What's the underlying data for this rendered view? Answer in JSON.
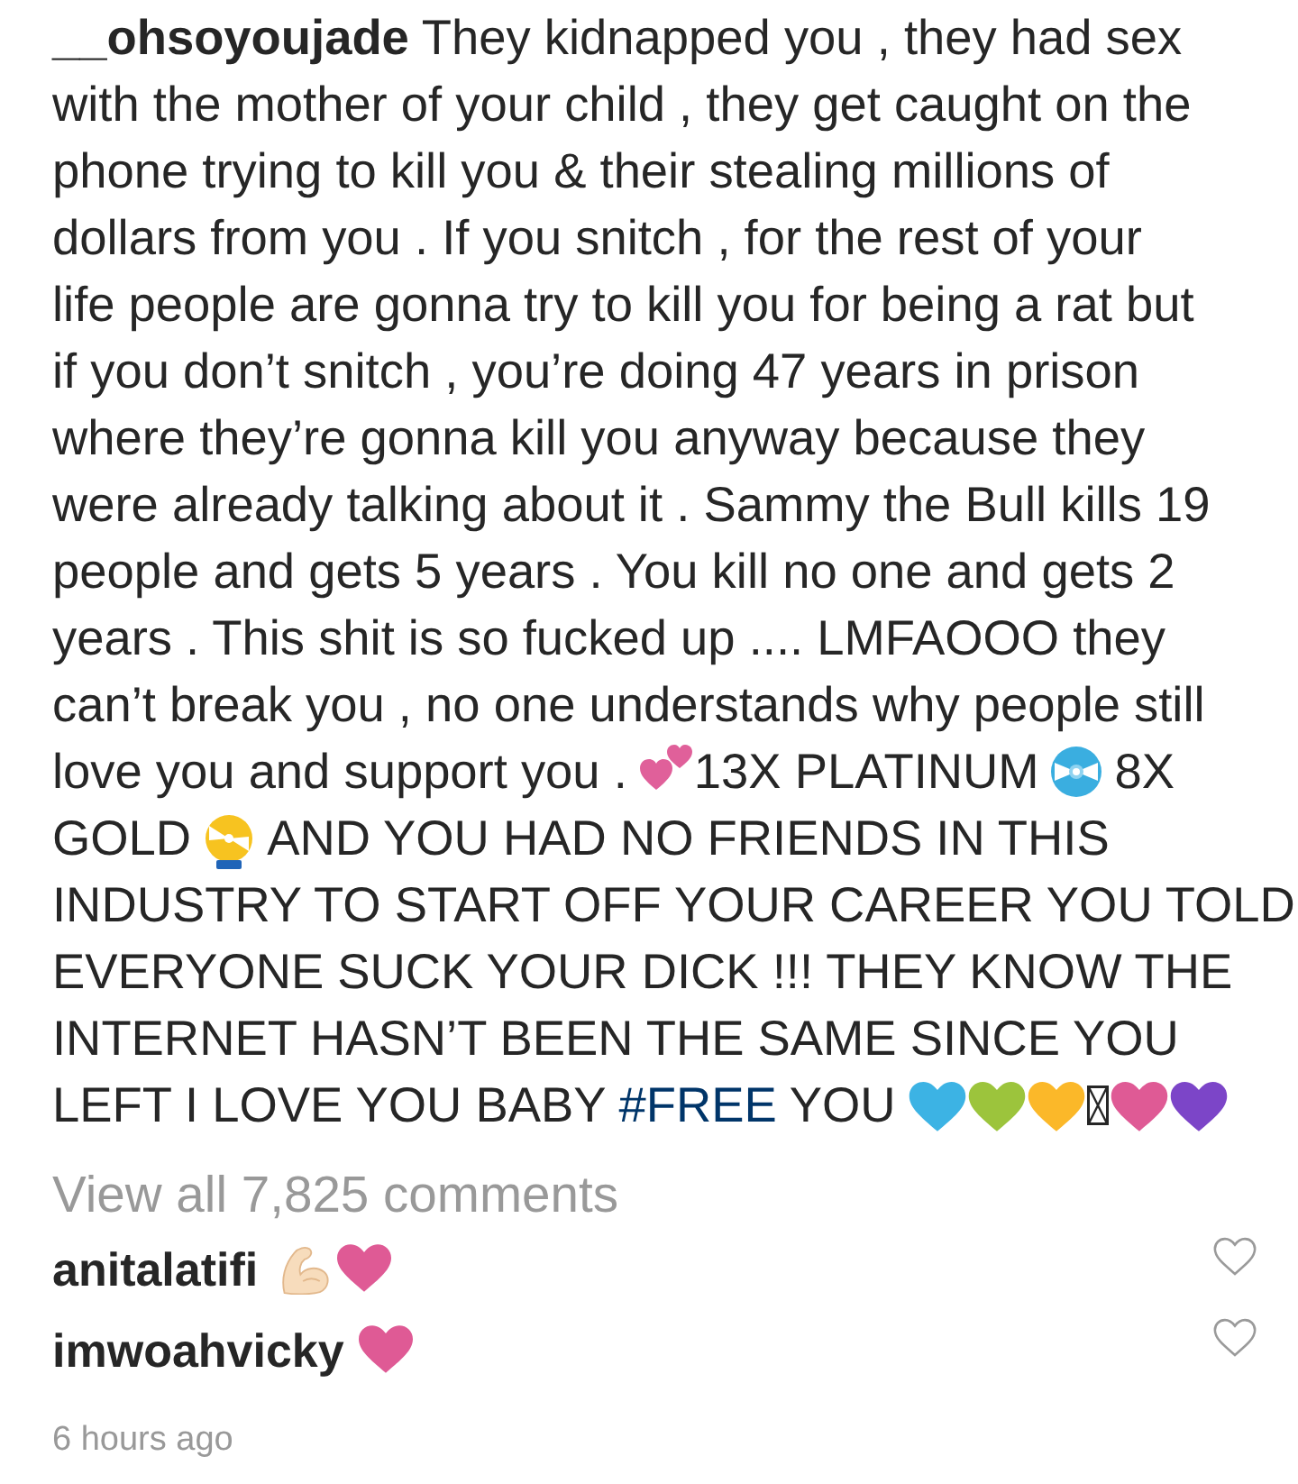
{
  "caption_lines": [
    [
      {
        "kind": "username",
        "text": "__ohsoyoujade"
      },
      {
        "kind": "text",
        "text": "They kidnapped you , they had sex"
      }
    ],
    [
      {
        "kind": "text",
        "text": "with the mother of your child , they get caught on the"
      }
    ],
    [
      {
        "kind": "text",
        "text": "phone trying to kill you & their stealing millions of"
      }
    ],
    [
      {
        "kind": "text",
        "text": "dollars from you . If you snitch , for the rest of your"
      }
    ],
    [
      {
        "kind": "text",
        "text": "life people are gonna try to kill you for being a rat but"
      }
    ],
    [
      {
        "kind": "text",
        "text": "if you don’t snitch , you’re doing 47 years in prison"
      }
    ],
    [
      {
        "kind": "text",
        "text": "where they’re gonna kill you anyway because they"
      }
    ],
    [
      {
        "kind": "text",
        "text": "were already talking about it . Sammy the Bull kills 19"
      }
    ],
    [
      {
        "kind": "text",
        "text": "people and gets 5 years . You kill no one and gets 2"
      }
    ],
    [
      {
        "kind": "text",
        "text": "years . This shit is so fucked up .... LMFAOOO they"
      }
    ],
    [
      {
        "kind": "text",
        "text": "can’t break you , no one understands why people still"
      }
    ],
    [
      {
        "kind": "text",
        "text": "love you and support you ."
      },
      {
        "kind": "two-hearts"
      },
      {
        "kind": "text",
        "text": "13X PLATINUM"
      },
      {
        "kind": "disc"
      },
      {
        "kind": "text",
        "text": "8X"
      }
    ],
    [
      {
        "kind": "text",
        "text": "GOLD"
      },
      {
        "kind": "dvd-disc"
      },
      {
        "kind": "text",
        "text": "AND YOU HAD NO FRIENDS IN THIS"
      }
    ],
    [
      {
        "kind": "text",
        "text": "INDUSTRY TO START OFF YOUR CAREER YOU TOLD"
      }
    ],
    [
      {
        "kind": "text",
        "text": "EVERYONE SUCK YOUR DICK !!! THEY KNOW THE"
      }
    ],
    [
      {
        "kind": "text",
        "text": "INTERNET HASN’T BEEN THE SAME SINCE YOU"
      }
    ],
    [
      {
        "kind": "text",
        "text": "LEFT I LOVE YOU BABY"
      },
      {
        "kind": "hashtag",
        "text": "#FREE"
      },
      {
        "kind": "text",
        "text": "YOU"
      },
      {
        "kind": "heart",
        "color": "#3cb3e4"
      },
      {
        "kind": "heart",
        "color": "#9cc43c"
      },
      {
        "kind": "heart",
        "color": "#fbb829"
      },
      {
        "kind": "missing-glyph"
      },
      {
        "kind": "heart",
        "color": "#df5a95"
      },
      {
        "kind": "heart",
        "color": "#7c45c8"
      }
    ]
  ],
  "view_all": "View all 7,825 comments",
  "comments": [
    {
      "username": "anitalatifi",
      "emojis": [
        {
          "kind": "flexed-arm"
        },
        {
          "kind": "heart",
          "color": "#df5a95"
        }
      ],
      "liked": false
    },
    {
      "username": "imwoahvicky",
      "emojis": [
        {
          "kind": "heart",
          "color": "#df5a95"
        }
      ],
      "liked": false
    }
  ],
  "timestamp": "6 hours ago"
}
